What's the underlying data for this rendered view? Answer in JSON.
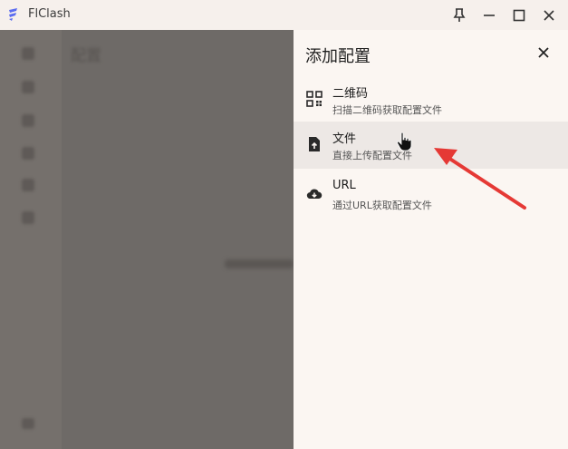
{
  "window": {
    "title": "FlClash",
    "icons": [
      "app-logo",
      "pin-icon",
      "minimize-icon",
      "maximize-icon",
      "close-icon"
    ]
  },
  "background": {
    "page_title": "配置"
  },
  "sheet": {
    "title": "添加配置",
    "close_icon": "close-icon",
    "options": [
      {
        "title": "二维码",
        "description": "扫描二维码获取配置文件",
        "icon": "qr-code-icon"
      },
      {
        "title": "文件",
        "description": "直接上传配置文件",
        "icon": "file-upload-icon"
      },
      {
        "title": "URL",
        "description": "通过URL获取配置文件",
        "icon": "cloud-download-icon"
      }
    ]
  },
  "annotation": {
    "color": "#e53935",
    "icon": "red-arrow"
  },
  "colors": {
    "sheet_bg": "#fbf6f2",
    "highlight_bg": "#ede8e5",
    "scrim": "#6e6a67",
    "titlebar_bg": "#f6f0ec"
  }
}
